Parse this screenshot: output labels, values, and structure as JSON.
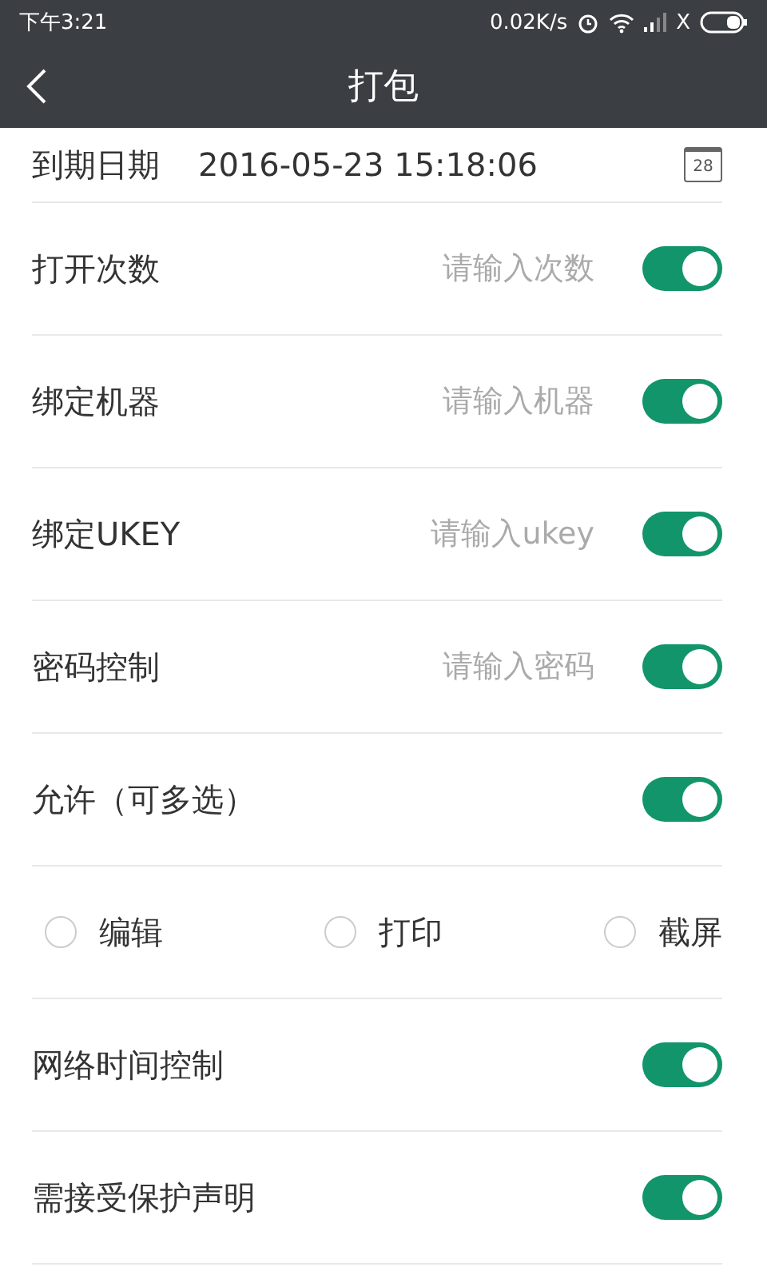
{
  "status_bar": {
    "time": "下午3:21",
    "speed": "0.02K/s",
    "carrier": "X"
  },
  "header": {
    "title": "打包"
  },
  "date_row": {
    "label": "到期日期",
    "value": "2016-05-23 15:18:06",
    "calendar_day": "28"
  },
  "rows": [
    {
      "kind": "input",
      "label": "打开次数",
      "placeholder": "请输入次数",
      "on": true
    },
    {
      "kind": "input",
      "label": "绑定机器",
      "placeholder": "请输入机器",
      "on": true
    },
    {
      "kind": "input",
      "label": "绑定UKEY",
      "placeholder": "请输入ukey",
      "on": true
    },
    {
      "kind": "input",
      "label": "密码控制",
      "placeholder": "请输入密码",
      "on": true
    },
    {
      "kind": "toggle",
      "label": "允许（可多选）",
      "on": true
    },
    {
      "kind": "options",
      "options": [
        {
          "label": "编辑",
          "checked": false
        },
        {
          "label": "打印",
          "checked": false
        },
        {
          "label": "截屏",
          "checked": false
        }
      ]
    },
    {
      "kind": "toggle",
      "label": "网络时间控制",
      "on": true
    },
    {
      "kind": "toggle",
      "label": "需接受保护声明",
      "on": true
    }
  ]
}
